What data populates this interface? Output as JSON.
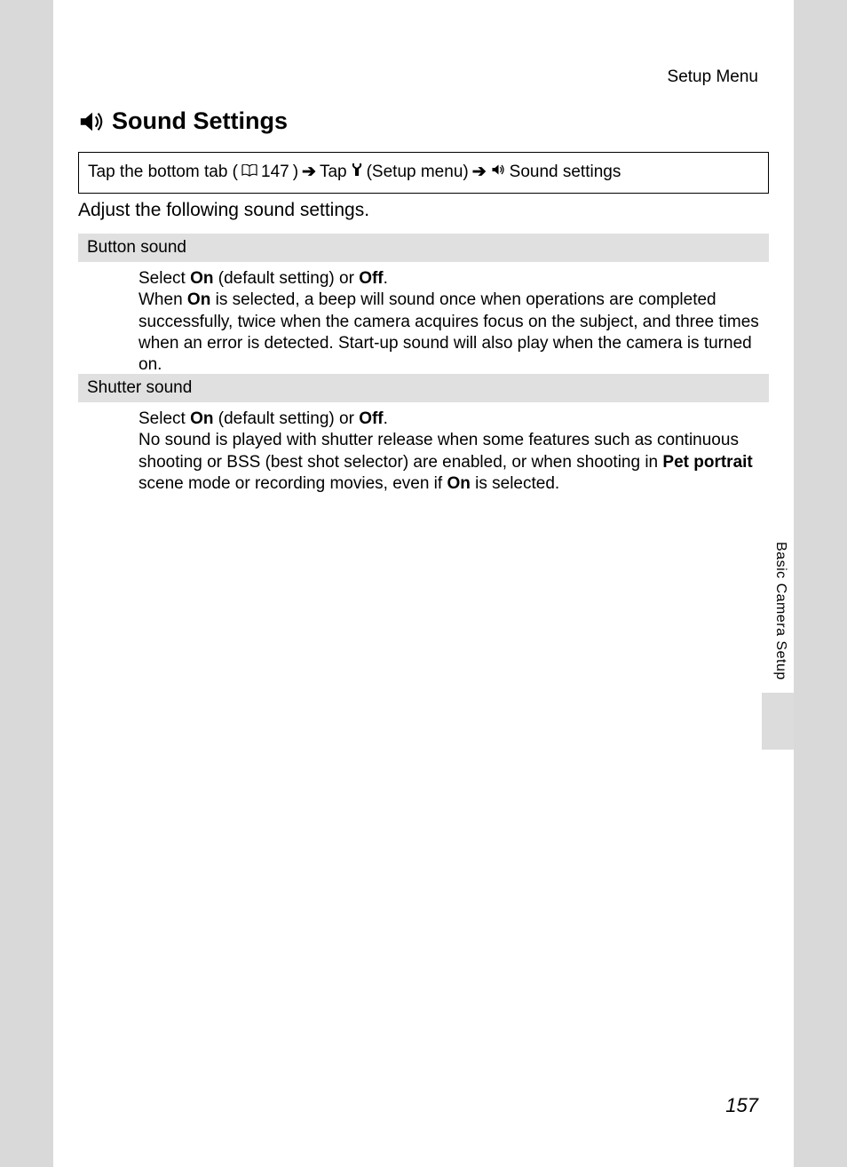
{
  "header": "Setup Menu",
  "title": "Sound Settings",
  "nav": {
    "pre": "Tap the bottom tab (",
    "pageref": "147",
    "post1": ")",
    "tap": "Tap",
    "setup_menu": "(Setup menu)",
    "sound_settings": "Sound settings"
  },
  "intro": "Adjust the following sound settings.",
  "sections": [
    {
      "heading": "Button sound",
      "body_parts": {
        "p1a": "Select ",
        "p1b_on": "On",
        "p1c": " (default setting) or ",
        "p1d_off": "Off",
        "p1e": ".",
        "p2a": "When ",
        "p2b_on": "On",
        "p2c": " is selected, a beep will sound once when operations are completed successfully, twice when the camera acquires focus on the subject, and three times when an error is detected. Start-up sound will also play when the camera is turned on."
      }
    },
    {
      "heading": "Shutter sound",
      "body_parts": {
        "p1a": "Select ",
        "p1b_on": "On",
        "p1c": " (default setting) or ",
        "p1d_off": "Off",
        "p1e": ".",
        "p2a": "No sound is played with shutter release when some features such as continuous shooting or BSS (best shot selector) are enabled, or when shooting in ",
        "p2b_pet": "Pet portrait",
        "p2c": " scene mode or recording movies, even if ",
        "p2d_on": "On",
        "p2e": " is selected."
      }
    }
  ],
  "side_label": "Basic Camera Setup",
  "page_number": "157",
  "arrow": "➔"
}
